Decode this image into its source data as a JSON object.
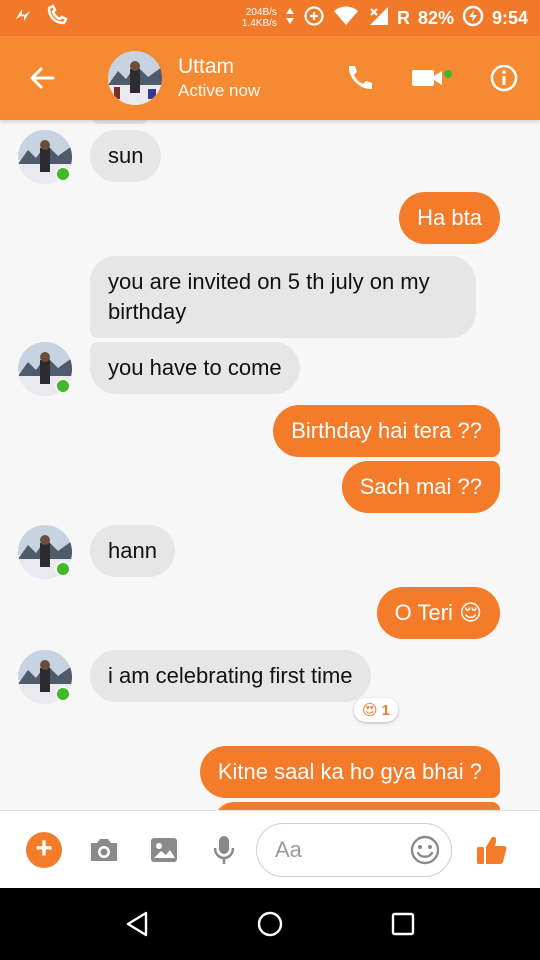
{
  "status_bar": {
    "speed_down": "204B/s",
    "speed_up": "1.4KB/s",
    "carrier": "R",
    "battery": "82%",
    "time": "9:54"
  },
  "header": {
    "name": "Uttam",
    "status": "Active now"
  },
  "messages": [
    {
      "dir": "in",
      "text": "sun"
    },
    {
      "dir": "out",
      "text": "Ha bta"
    },
    {
      "dir": "in",
      "text": "you are invited on 5 th july on my birthday"
    },
    {
      "dir": "in",
      "text": "you have to come"
    },
    {
      "dir": "out",
      "text": "Birthday hai tera ??"
    },
    {
      "dir": "out",
      "text": "Sach mai ??"
    },
    {
      "dir": "in",
      "text": "hann"
    },
    {
      "dir": "out",
      "text": "O Teri",
      "emoji": "😌"
    },
    {
      "dir": "in",
      "text": "i am celebrating first time",
      "reaction": {
        "emoji": "😍",
        "count": "1"
      }
    },
    {
      "dir": "out",
      "text": "Kitne saal ka ho gya bhai ?"
    }
  ],
  "composer": {
    "placeholder": "Aa"
  },
  "colors": {
    "accent": "#f58a33",
    "outgoing_bubble": "#f47b2a",
    "incoming_bubble": "#e6e6e6",
    "online": "#42b72a"
  }
}
